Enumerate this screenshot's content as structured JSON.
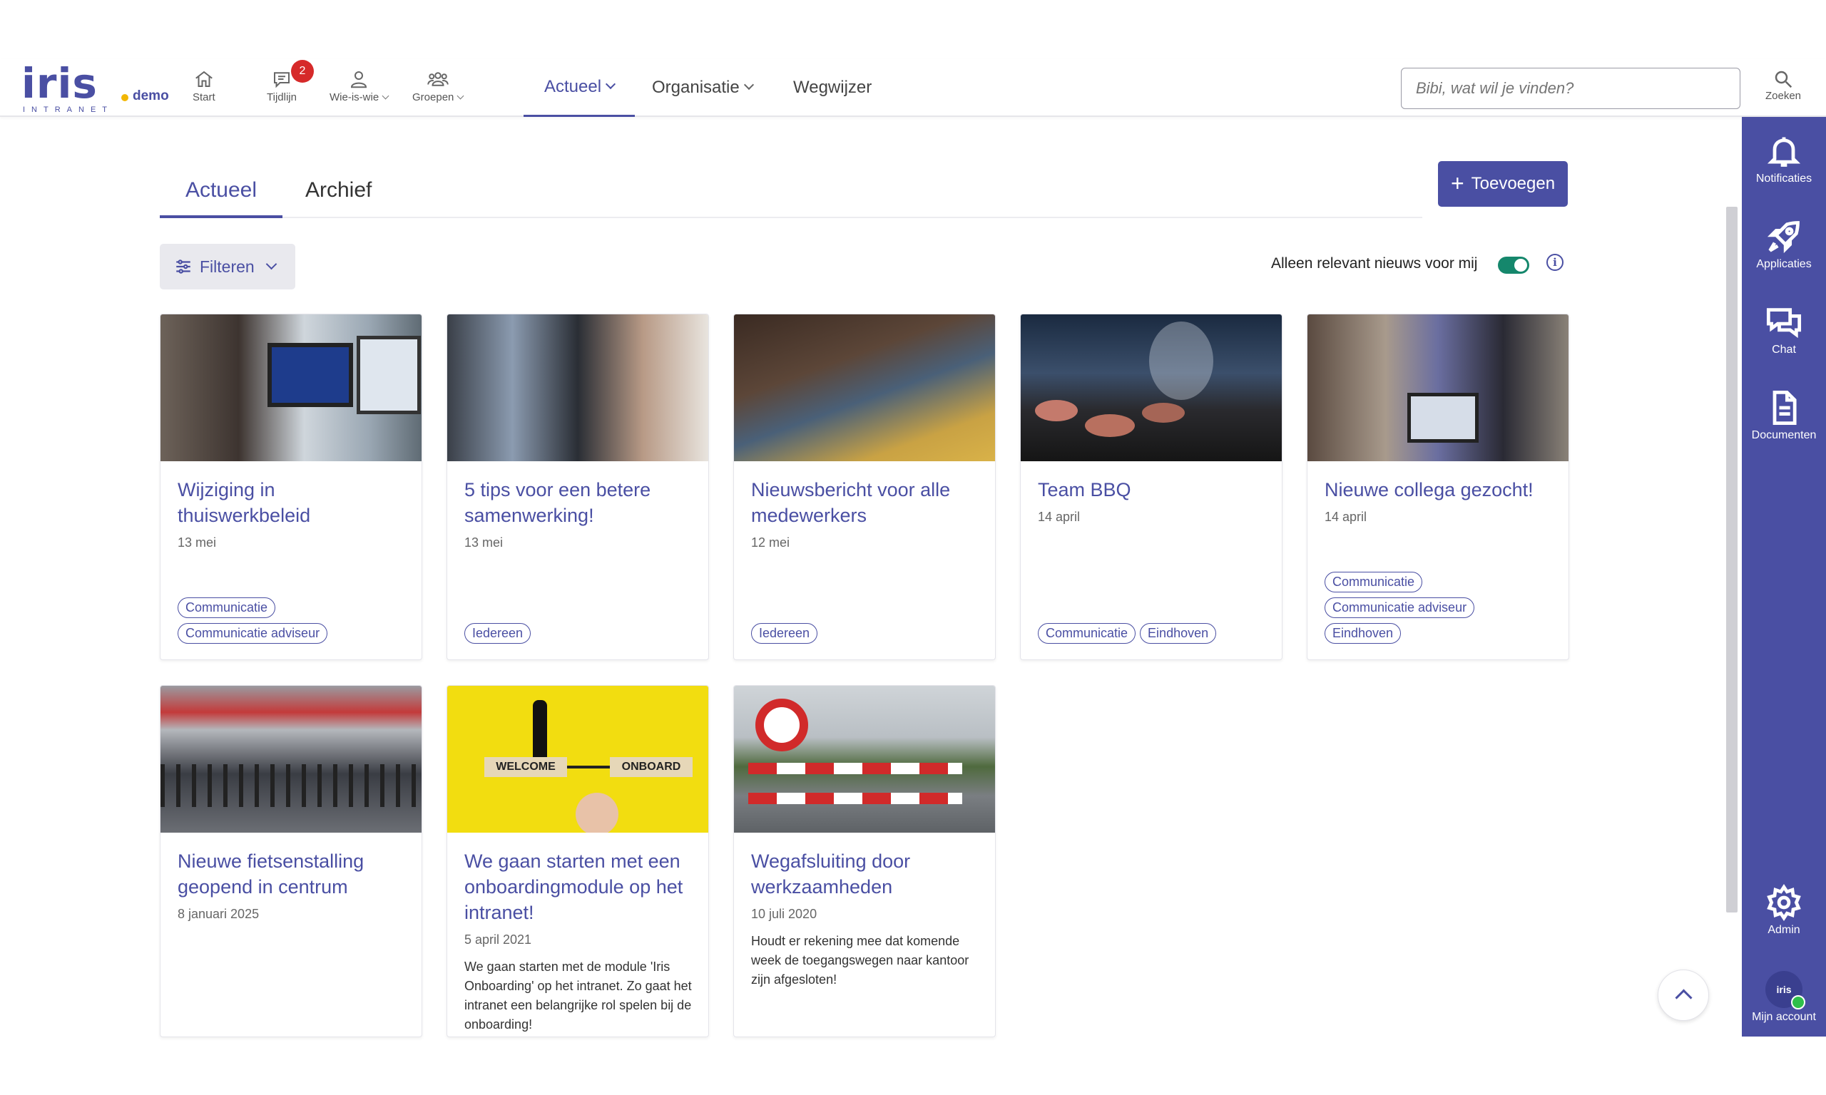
{
  "header": {
    "logo_text": "Iris",
    "logo_suffix": "demo",
    "logo_sub": "INTRANET",
    "icon_nav": [
      {
        "label": "Start",
        "icon": "home-icon"
      },
      {
        "label": "Tijdlijn",
        "icon": "chat-bubble-icon",
        "badge": "2"
      },
      {
        "label": "Wie-is-wie",
        "icon": "person-icon"
      },
      {
        "label": "Groepen",
        "icon": "group-icon"
      }
    ],
    "main_nav": [
      {
        "label": "Actueel",
        "active": true
      },
      {
        "label": "Organisatie"
      },
      {
        "label": "Wegwijzer"
      }
    ],
    "search_placeholder": "Bibi, wat wil je vinden?",
    "search_label": "Zoeken"
  },
  "sidebar": {
    "items": [
      {
        "label": "Notificaties",
        "icon": "bell-icon"
      },
      {
        "label": "Applicaties",
        "icon": "rocket-icon"
      },
      {
        "label": "Chat",
        "icon": "chat-icon"
      },
      {
        "label": "Documenten",
        "icon": "document-icon"
      },
      {
        "label": "Admin",
        "icon": "gear-icon"
      },
      {
        "label": "Mijn account",
        "icon": "avatar-icon",
        "avatar_text": "Iris"
      }
    ]
  },
  "main": {
    "tabs": [
      {
        "label": "Actueel",
        "active": true
      },
      {
        "label": "Archief"
      }
    ],
    "add_button": "Toevoegen",
    "filter_label": "Filteren",
    "relevant_label": "Alleen relevant nieuws voor mij",
    "relevant_on": true,
    "cards": [
      {
        "title": "Wijziging in thuiswerkbeleid",
        "date": "13 mei",
        "tags": [
          "Communicatie",
          "Communicatie adviseur"
        ]
      },
      {
        "title": "5 tips voor een betere samenwerking!",
        "date": "13 mei",
        "tags": [
          "Iedereen"
        ]
      },
      {
        "title": "Nieuwsbericht voor alle medewerkers",
        "date": "12 mei",
        "tags": [
          "Iedereen"
        ]
      },
      {
        "title": "Team BBQ",
        "date": "14 april",
        "tags": [
          "Communicatie",
          "Eindhoven"
        ]
      },
      {
        "title": "Nieuwe collega gezocht!",
        "date": "14 april",
        "tags": [
          "Communicatie",
          "Communicatie adviseur",
          "Eindhoven"
        ]
      },
      {
        "title": "Nieuwe fietsenstalling geopend in centrum",
        "date": "8 januari 2025",
        "tags": []
      },
      {
        "title": "We gaan starten met een onboardingmodule op het intranet!",
        "date": "5 april 2021",
        "desc": "We gaan starten met de module 'Iris Onboarding' op het intranet. Zo gaat het intranet een belangrijke rol spelen bij de onboarding!",
        "tags": [],
        "img_words": [
          "WELCOME",
          "ONBOARD"
        ]
      },
      {
        "title": "Wegafsluiting door werkzaamheden",
        "date": "10 juli 2020",
        "desc": "Houdt er rekening mee dat komende week de toegangswegen naar kantoor zijn afgesloten!",
        "tags": []
      }
    ]
  },
  "colors": {
    "brand": "#4a4fa3",
    "badge": "#d62a2a",
    "toggle": "#15876c",
    "logo_dot": "#f2b705"
  }
}
